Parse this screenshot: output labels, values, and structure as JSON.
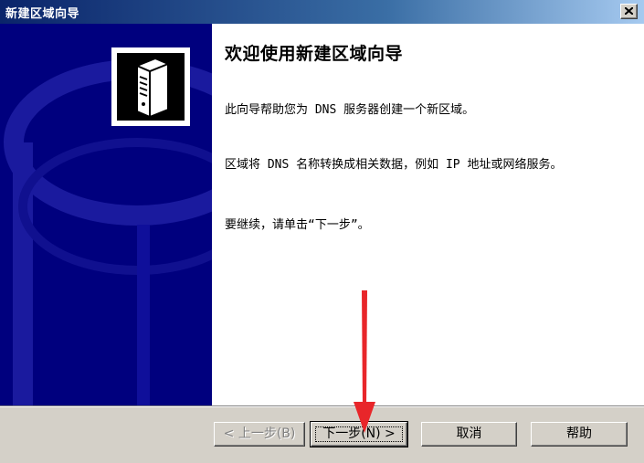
{
  "window": {
    "title": "新建区域向导"
  },
  "content": {
    "heading": "欢迎使用新建区域向导",
    "paragraph1": "此向导帮助您为 DNS 服务器创建一个新区域。",
    "paragraph2": "区域将 DNS 名称转换成相关数据，例如 IP 地址或网络服务。",
    "paragraph3": "要继续，请单击“下一步”。"
  },
  "buttons": {
    "back": "< 上一步(B)",
    "next": "下一步(N) >",
    "cancel": "取消",
    "help": "帮助"
  },
  "icons": {
    "close": "close-icon",
    "side_image": "server-tower-icon"
  },
  "colors": {
    "side_panel": "#00007e",
    "arrow": "#e8262a"
  }
}
